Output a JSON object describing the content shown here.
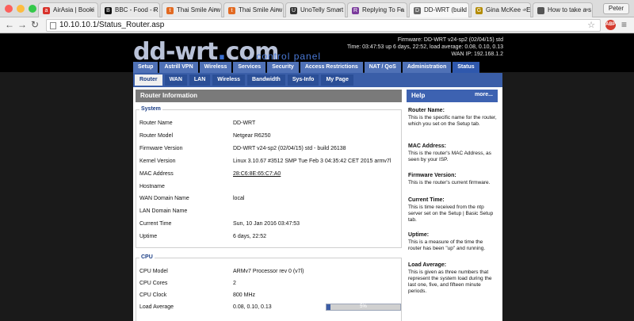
{
  "browser": {
    "tabs": [
      {
        "label": "AirAsia | Booki",
        "color": "#d8312a",
        "glyph": "a"
      },
      {
        "label": "BBC - Food - R",
        "color": "#111111",
        "glyph": "B"
      },
      {
        "label": "Thai Smile Airw",
        "color": "#e26a22",
        "glyph": "t"
      },
      {
        "label": "Thai Smile Airw",
        "color": "#e26a22",
        "glyph": "t"
      },
      {
        "label": "UnoTelly Smart",
        "color": "#333333",
        "glyph": "U"
      },
      {
        "label": "Replying To Fa",
        "color": "#7a3a9c",
        "glyph": "R"
      },
      {
        "label": "DD-WRT (build",
        "color": "#666666",
        "glyph": "D"
      },
      {
        "label": "Gina McKee - E",
        "color": "#b38b00",
        "glyph": "G"
      },
      {
        "label": "How to take a s",
        "color": "#555555",
        "glyph": ""
      }
    ],
    "user": "Peter",
    "url": "10.10.10.1/Status_Router.asp",
    "abp_label": "ABP"
  },
  "header": {
    "logo_main": "dd-wrt",
    "logo_dot": ".",
    "logo_tld": "com",
    "tagline": "... control panel",
    "firmware": "Firmware: DD-WRT v24-sp2 (02/04/15) std",
    "time": "Time: 03:47:53 up 6 days, 22:52, load average: 0.08, 0.10, 0.13",
    "wan_ip": "WAN IP: 192.168.1.2"
  },
  "mainnav": [
    "Setup",
    "Astrill VPN",
    "Wireless",
    "Services",
    "Security",
    "Access Restrictions",
    "NAT / QoS",
    "Administration",
    "Status"
  ],
  "subnav": [
    "Router",
    "WAN",
    "LAN",
    "Wireless",
    "Bandwidth",
    "Sys-Info",
    "My Page"
  ],
  "section_title": "Router Information",
  "system": {
    "legend": "System",
    "rows": [
      {
        "label": "Router Name",
        "value": "DD-WRT"
      },
      {
        "label": "Router Model",
        "value": "Netgear R6250"
      },
      {
        "label": "Firmware Version",
        "value": "DD-WRT v24-sp2 (02/04/15) std - build 26138"
      },
      {
        "label": "Kernel Version",
        "value": "Linux 3.10.67 #3512 SMP Tue Feb 3 04:35:42 CET 2015 armv7l"
      },
      {
        "label": "MAC Address",
        "value": "28:C6:8E:65:C7:A0"
      },
      {
        "label": "Hostname",
        "value": ""
      },
      {
        "label": "WAN Domain Name",
        "value": "local"
      },
      {
        "label": "LAN Domain Name",
        "value": ""
      },
      {
        "label": "Current Time",
        "value": "Sun, 10 Jan 2016 03:47:53"
      },
      {
        "label": "Uptime",
        "value": "6 days, 22:52"
      }
    ]
  },
  "cpu": {
    "legend": "CPU",
    "rows": [
      {
        "label": "CPU Model",
        "value": "ARMv7 Processor rev 0 (v7l)"
      },
      {
        "label": "CPU Cores",
        "value": "2"
      },
      {
        "label": "CPU Clock",
        "value": "800 MHz"
      },
      {
        "label": "Load Average",
        "value": "0.08, 0.10, 0.13"
      }
    ],
    "load_percent": 5,
    "load_label": "5%"
  },
  "help": {
    "title": "Help",
    "more": "more...",
    "items": [
      {
        "title": "Router Name:",
        "text": "This is the specific name for the router, which you set on the Setup tab."
      },
      {
        "title": "MAC Address:",
        "text": "This is the router's MAC Address, as seen by your ISP."
      },
      {
        "title": "Firmware Version:",
        "text": "This is the router's current firmware."
      },
      {
        "title": "Current Time:",
        "text": "This is time received from the ntp server set on the Setup | Basic Setup tab."
      },
      {
        "title": "Uptime:",
        "text": "This is a measure of the time the router has been \"up\" and running."
      },
      {
        "title": "Load Average:",
        "text": "This is given as three numbers that represent the system load during the last one, five, and fifteen minute periods."
      }
    ]
  }
}
